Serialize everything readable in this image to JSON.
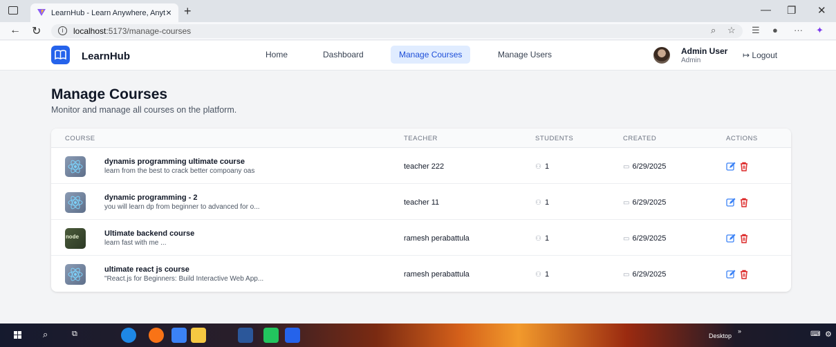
{
  "browser": {
    "tab_title": "LearnHub - Learn Anywhere, Anyt",
    "url_host": "localhost",
    "url_rest": ":5173/manage-courses"
  },
  "nav": {
    "brand": "LearnHub",
    "links": [
      "Home",
      "Dashboard",
      "Manage Courses",
      "Manage Users"
    ],
    "active": "Manage Courses",
    "user_name": "Admin User",
    "user_role": "Admin",
    "logout": "Logout"
  },
  "page": {
    "title": "Manage Courses",
    "subtitle": "Monitor and manage all courses on the platform."
  },
  "table": {
    "headers": [
      "COURSE",
      "TEACHER",
      "STUDENTS",
      "CREATED",
      "ACTIONS"
    ],
    "rows": [
      {
        "title": "dynamis programming ultimate course",
        "desc": "learn from the best to crack better compoany oas",
        "teacher": "teacher 222",
        "students": "1",
        "created": "6/29/2025",
        "thumb": "react"
      },
      {
        "title": "dynamic programming - 2",
        "desc": "you will learn dp from beginner to advanced for o...",
        "teacher": "teacher 11",
        "students": "1",
        "created": "6/29/2025",
        "thumb": "react"
      },
      {
        "title": "Ultimate backend course",
        "desc": "learn fast with me ...",
        "teacher": "ramesh perabattula",
        "students": "1",
        "created": "6/29/2025",
        "thumb": "node"
      },
      {
        "title": "ultimate react js course",
        "desc": "\"React.js for Beginners: Build Interactive Web App...",
        "teacher": "ramesh perabattula",
        "students": "1",
        "created": "6/29/2025",
        "thumb": "react"
      }
    ]
  },
  "thumb_text": {
    "node": "node"
  },
  "taskbar": {
    "desktop_label": "Desktop"
  },
  "colors": {
    "accent": "#2563eb",
    "delete": "#dc2626",
    "edit": "#3b82f6"
  }
}
